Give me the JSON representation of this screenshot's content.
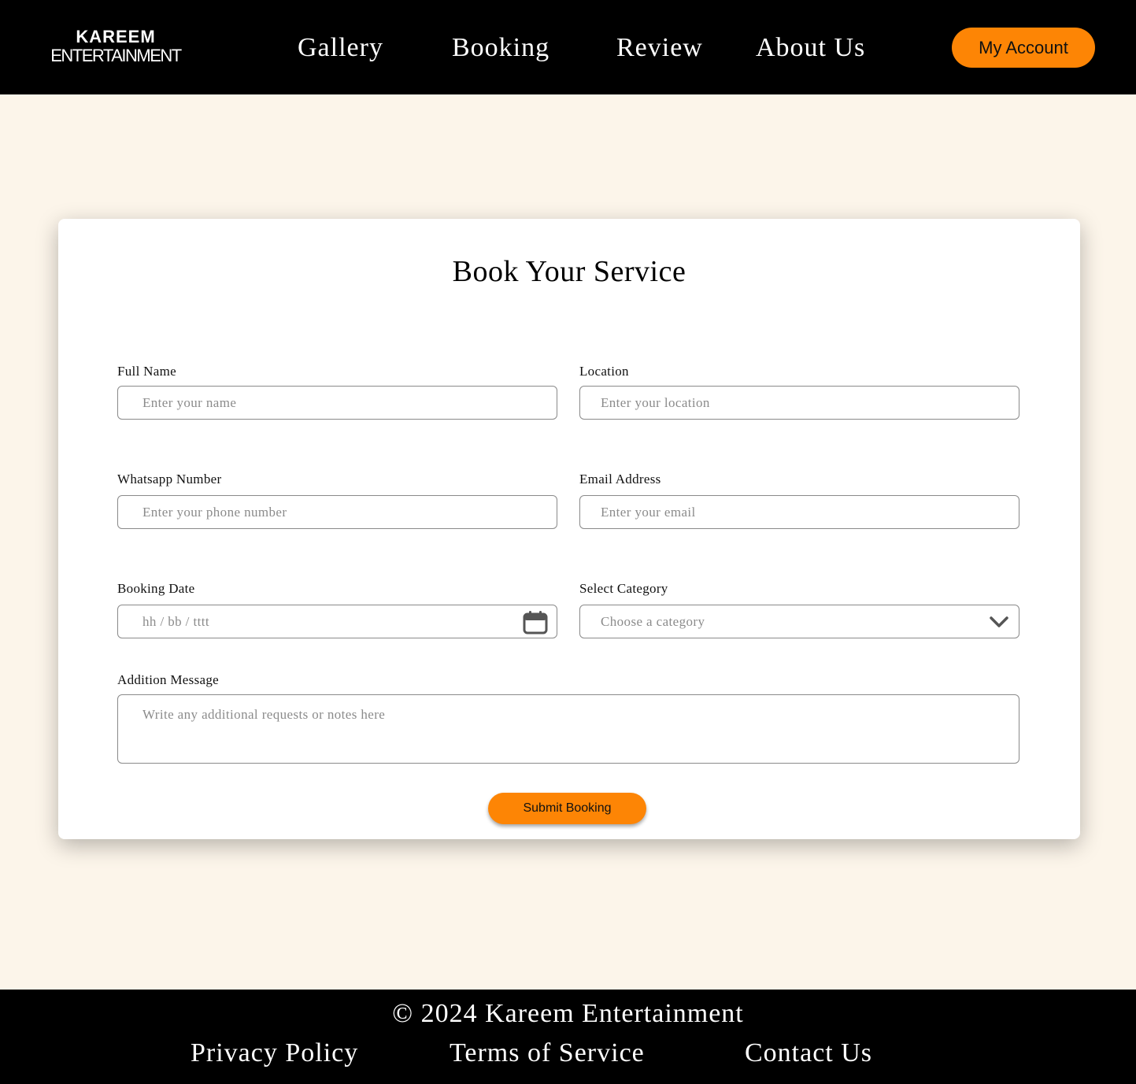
{
  "header": {
    "logo_top": "KAREEM",
    "logo_bottom": "ENTERTAINMENT",
    "nav": [
      "Gallery",
      "Booking",
      "Review",
      "About Us"
    ],
    "account_label": "My Account"
  },
  "form": {
    "title": "Book Your Service",
    "full_name": {
      "label": "Full Name",
      "placeholder": "Enter your name"
    },
    "location": {
      "label": "Location",
      "placeholder": "Enter your location"
    },
    "whatsapp": {
      "label": "Whatsapp Number",
      "placeholder": "Enter your phone number"
    },
    "email": {
      "label": "Email Address",
      "placeholder": "Enter your email"
    },
    "booking_date": {
      "label": "Booking Date",
      "placeholder": "hh / bb / tttt",
      "icon": "calendar-icon"
    },
    "category": {
      "label": "Select Category",
      "placeholder": "Choose a category",
      "icon": "chevron-down-icon"
    },
    "message": {
      "label": "Addition Message",
      "placeholder": "Write any additional requests or notes here"
    },
    "submit_label": "Submit Booking"
  },
  "footer": {
    "copyright": "© 2024 Kareem Entertainment",
    "links": [
      "Privacy Policy",
      "Terms of Service",
      "Contact Us"
    ]
  },
  "colors": {
    "accent": "#fd8505",
    "page_bg": "#fcf5ea",
    "header_bg": "#000000"
  }
}
